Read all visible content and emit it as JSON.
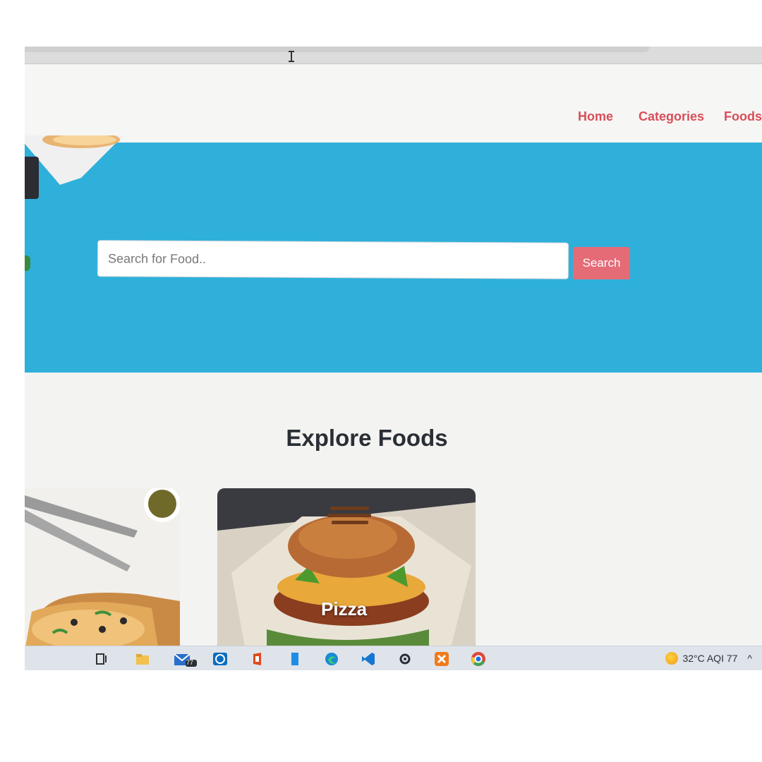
{
  "nav": {
    "home": "Home",
    "categories": "Categories",
    "foods": "Foods"
  },
  "search": {
    "placeholder": "Search for Food..",
    "button_label": "Search"
  },
  "explore": {
    "title": "Explore Foods",
    "cards": [
      {
        "label": ""
      },
      {
        "label": "Pizza"
      }
    ]
  },
  "taskbar": {
    "icons": [
      "task-view-icon",
      "file-explorer-icon",
      "mail-icon",
      "dell-icon",
      "office-icon",
      "store-icon",
      "edge-icon",
      "vscode-icon",
      "settings-icon",
      "xampp-icon",
      "chrome-icon"
    ],
    "mail_badge": "77",
    "weather": "32°C AQI 77"
  },
  "colors": {
    "accent": "#d84e5a",
    "hero_bg": "#2eb0db",
    "search_button": "#e56b77"
  }
}
